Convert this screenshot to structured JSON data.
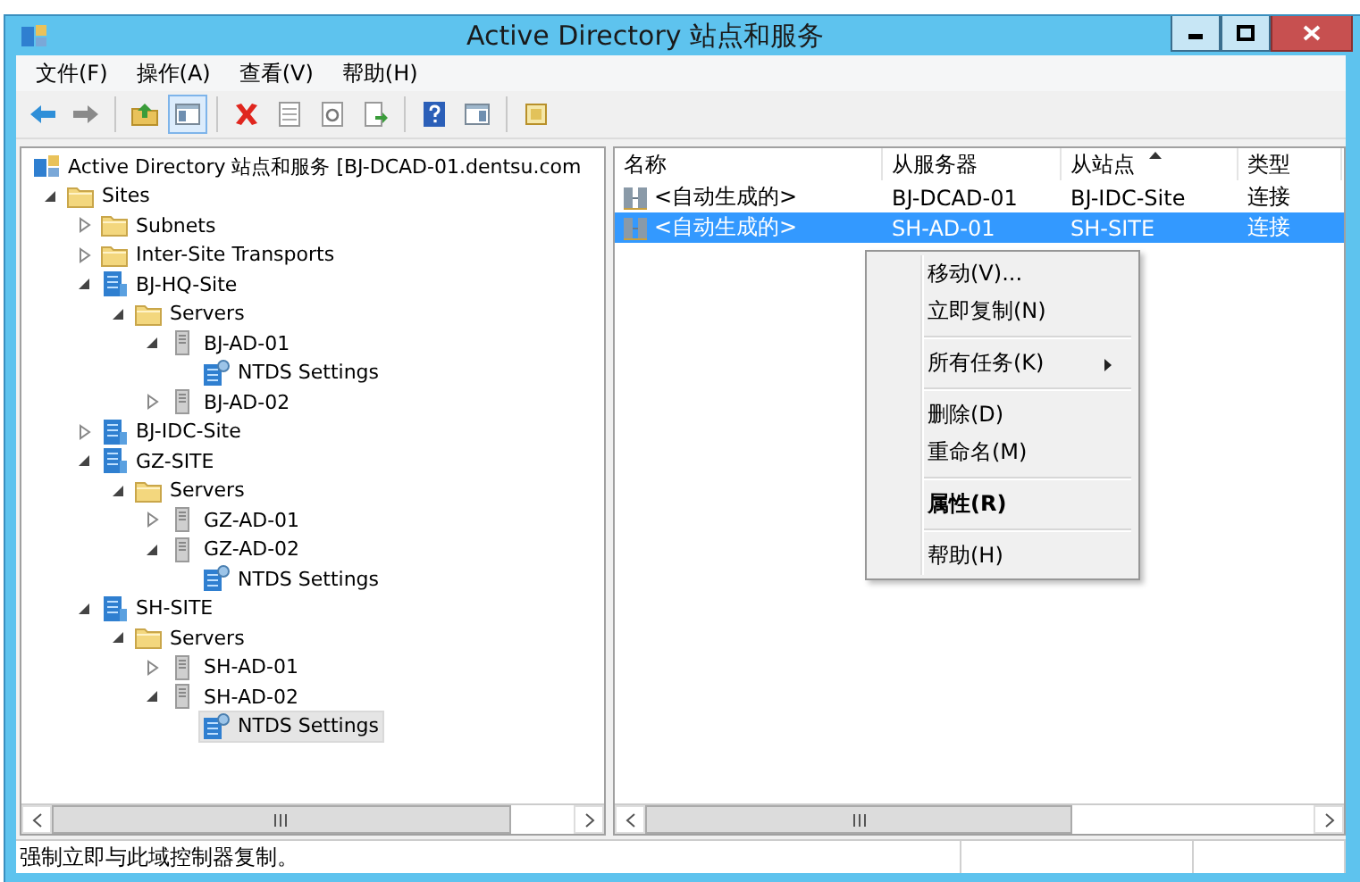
{
  "window": {
    "title": "Active Directory 站点和服务"
  },
  "menu_bar": [
    "文件(F)",
    "操作(A)",
    "查看(V)",
    "帮助(H)"
  ],
  "toolbar": [
    {
      "kind": "back"
    },
    {
      "kind": "forward"
    },
    {
      "kind": "separator"
    },
    {
      "kind": "up"
    },
    {
      "kind": "tree",
      "pressed": true
    },
    {
      "kind": "separator"
    },
    {
      "kind": "delete"
    },
    {
      "kind": "properties"
    },
    {
      "kind": "refresh"
    },
    {
      "kind": "export"
    },
    {
      "kind": "separator"
    },
    {
      "kind": "help"
    },
    {
      "kind": "action-pane"
    },
    {
      "kind": "separator"
    },
    {
      "kind": "snapin"
    }
  ],
  "tree": [
    {
      "label": "Active Directory 站点和服务 [BJ-DCAD-01.dentsu.com",
      "kind": "root",
      "selected": false,
      "children": [
        {
          "label": "Sites",
          "kind": "folder",
          "expanded": true,
          "selected": false,
          "children": [
            {
              "label": "Subnets",
              "kind": "folder",
              "expanded": false,
              "selected": false
            },
            {
              "label": "Inter-Site Transports",
              "kind": "folder",
              "expanded": false,
              "selected": false
            },
            {
              "label": "BJ-HQ-Site",
              "kind": "site",
              "expanded": true,
              "selected": false,
              "children": [
                {
                  "label": "Servers",
                  "kind": "folder",
                  "expanded": true,
                  "selected": false,
                  "children": [
                    {
                      "label": "BJ-AD-01",
                      "kind": "server",
                      "expanded": true,
                      "selected": false,
                      "children": [
                        {
                          "label": "NTDS Settings",
                          "kind": "ntds",
                          "selected": false
                        }
                      ]
                    },
                    {
                      "label": "BJ-AD-02",
                      "kind": "server",
                      "expanded": false,
                      "selected": false
                    }
                  ]
                }
              ]
            },
            {
              "label": "BJ-IDC-Site",
              "kind": "site",
              "expanded": false,
              "selected": false
            },
            {
              "label": "GZ-SITE",
              "kind": "site",
              "expanded": true,
              "selected": false,
              "children": [
                {
                  "label": "Servers",
                  "kind": "folder",
                  "expanded": true,
                  "selected": false,
                  "children": [
                    {
                      "label": "GZ-AD-01",
                      "kind": "server",
                      "expanded": false,
                      "selected": false
                    },
                    {
                      "label": "GZ-AD-02",
                      "kind": "server",
                      "expanded": true,
                      "selected": false,
                      "children": [
                        {
                          "label": "NTDS Settings",
                          "kind": "ntds",
                          "selected": false
                        }
                      ]
                    }
                  ]
                }
              ]
            },
            {
              "label": "SH-SITE",
              "kind": "site",
              "expanded": true,
              "selected": false,
              "children": [
                {
                  "label": "Servers",
                  "kind": "folder",
                  "expanded": true,
                  "selected": false,
                  "children": [
                    {
                      "label": "SH-AD-01",
                      "kind": "server",
                      "expanded": false,
                      "selected": false
                    },
                    {
                      "label": "SH-AD-02",
                      "kind": "server",
                      "expanded": true,
                      "selected": false,
                      "children": [
                        {
                          "label": "NTDS Settings",
                          "kind": "ntds",
                          "selected": true
                        }
                      ]
                    }
                  ]
                }
              ]
            }
          ]
        }
      ]
    }
  ],
  "list": {
    "columns": [
      {
        "label": "名称",
        "sorted": false
      },
      {
        "label": "从服务器",
        "sorted": false
      },
      {
        "label": "从站点",
        "sorted": true
      },
      {
        "label": "类型",
        "sorted": false
      }
    ],
    "rows": [
      {
        "cells": [
          "<自动生成的>",
          "BJ-DCAD-01",
          "BJ-IDC-Site",
          "连接"
        ],
        "selected": false
      },
      {
        "cells": [
          "<自动生成的>",
          "SH-AD-01",
          "SH-SITE",
          "连接"
        ],
        "selected": true
      }
    ]
  },
  "context_menu": [
    {
      "kind": "item",
      "label": "移动(V)...",
      "default": false
    },
    {
      "kind": "item",
      "label": "立即复制(N)",
      "default": false
    },
    {
      "kind": "separator"
    },
    {
      "kind": "submenu",
      "label": "所有任务(K)",
      "default": false
    },
    {
      "kind": "separator"
    },
    {
      "kind": "item",
      "label": "删除(D)",
      "default": false
    },
    {
      "kind": "item",
      "label": "重命名(M)",
      "default": false
    },
    {
      "kind": "separator"
    },
    {
      "kind": "item",
      "label": "属性(R)",
      "default": true
    },
    {
      "kind": "separator"
    },
    {
      "kind": "item",
      "label": "帮助(H)",
      "default": false
    }
  ],
  "status_bar": {
    "text": "强制立即与此域控制器复制。"
  }
}
